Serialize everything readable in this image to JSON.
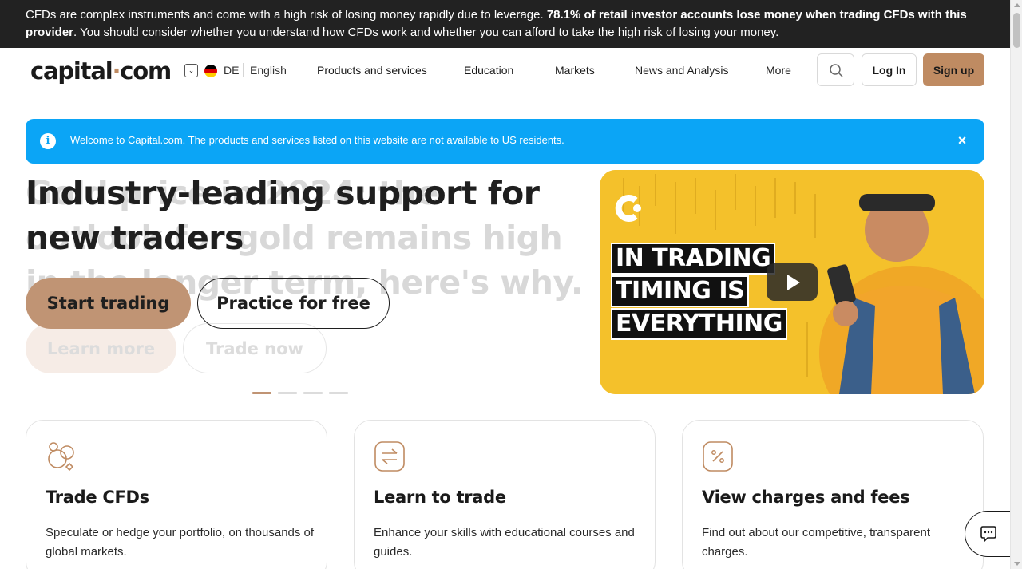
{
  "risk_warning": {
    "text_before": "CFDs are complex instruments and come with a high risk of losing money rapidly due to leverage. ",
    "text_bold": "78.1% of retail investor accounts lose money when trading CFDs with this provider",
    "text_after": ". You should consider whether you understand how CFDs work and whether you can afford to take the high risk of losing your money."
  },
  "header": {
    "logo_main": "capital",
    "logo_dot": "·",
    "logo_end": "com",
    "lang_code": "DE",
    "lang_name": "English",
    "nav": [
      "Products and services",
      "Education",
      "Markets",
      "News and Analysis",
      "More"
    ],
    "login": "Log In",
    "signup": "Sign up"
  },
  "notice": {
    "text": "Welcome to Capital.com. The products and services listed on this website are not available to US residents.",
    "close": "×"
  },
  "hero": {
    "ghost_title": "Gold price in 2024: the outlook for gold remains high in the longer term, here's why.",
    "title": "Industry-leading support for new traders",
    "primary": "Start trading",
    "secondary": "Practice for free",
    "ghost_primary": "Learn more",
    "ghost_secondary": "Trade now"
  },
  "video": {
    "caption": [
      "IN TRADING",
      "TIMING IS",
      "EVERYTHING"
    ]
  },
  "cards": [
    {
      "title": "Trade CFDs",
      "desc": "Speculate or hedge your portfolio, on thousands of global markets."
    },
    {
      "title": "Learn to trade",
      "desc": "Enhance your skills with educational courses and guides."
    },
    {
      "title": "View charges and fees",
      "desc": "Find out about our competitive, transparent charges."
    }
  ],
  "colors": {
    "accent": "#bf8b62",
    "notice": "#0ba5f6",
    "dark": "#222222"
  }
}
